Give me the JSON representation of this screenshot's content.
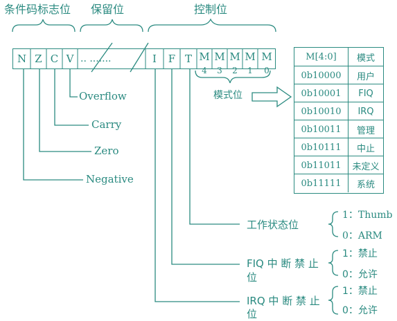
{
  "headers": {
    "condition": "条件码标志位",
    "reserved": "保留位",
    "control": "控制位"
  },
  "register": {
    "n": "N",
    "z": "Z",
    "c": "C",
    "v": "V",
    "reserved_dots": "..  .......",
    "i": "I",
    "f": "F",
    "t": "T",
    "m4": "M",
    "m3": "M",
    "m2": "M",
    "m1": "M",
    "m0": "M",
    "m4_sub": "4",
    "m3_sub": "3",
    "m2_sub": "2",
    "m1_sub": "1",
    "m0_sub": "0"
  },
  "flags": {
    "overflow": "Overflow",
    "carry": "Carry",
    "zero": "Zero",
    "negative": "Negative"
  },
  "mode_arrow_label": "模式位",
  "mode_table": {
    "header": [
      "M[4:0]",
      "模式"
    ],
    "rows": [
      [
        "0b10000",
        "用户"
      ],
      [
        "0b10001",
        "FIQ"
      ],
      [
        "0b10010",
        "IRQ"
      ],
      [
        "0b10011",
        "管理"
      ],
      [
        "0b10111",
        "中止"
      ],
      [
        "0b11011",
        "未定义"
      ],
      [
        "0b11111",
        "系统"
      ]
    ]
  },
  "t_bit": {
    "label": "工作状态位",
    "opt1": "1：Thumb",
    "opt0": "0：ARM"
  },
  "f_bit": {
    "label_line1": "FIQ 中 断 禁 止",
    "label_line2": "位",
    "opt1": "1：禁止",
    "opt0": "0：允许"
  },
  "i_bit": {
    "label_line1": "IRQ 中 断 禁 止",
    "label_line2": "位",
    "opt1": "1：禁止",
    "opt0": "0：允许"
  }
}
